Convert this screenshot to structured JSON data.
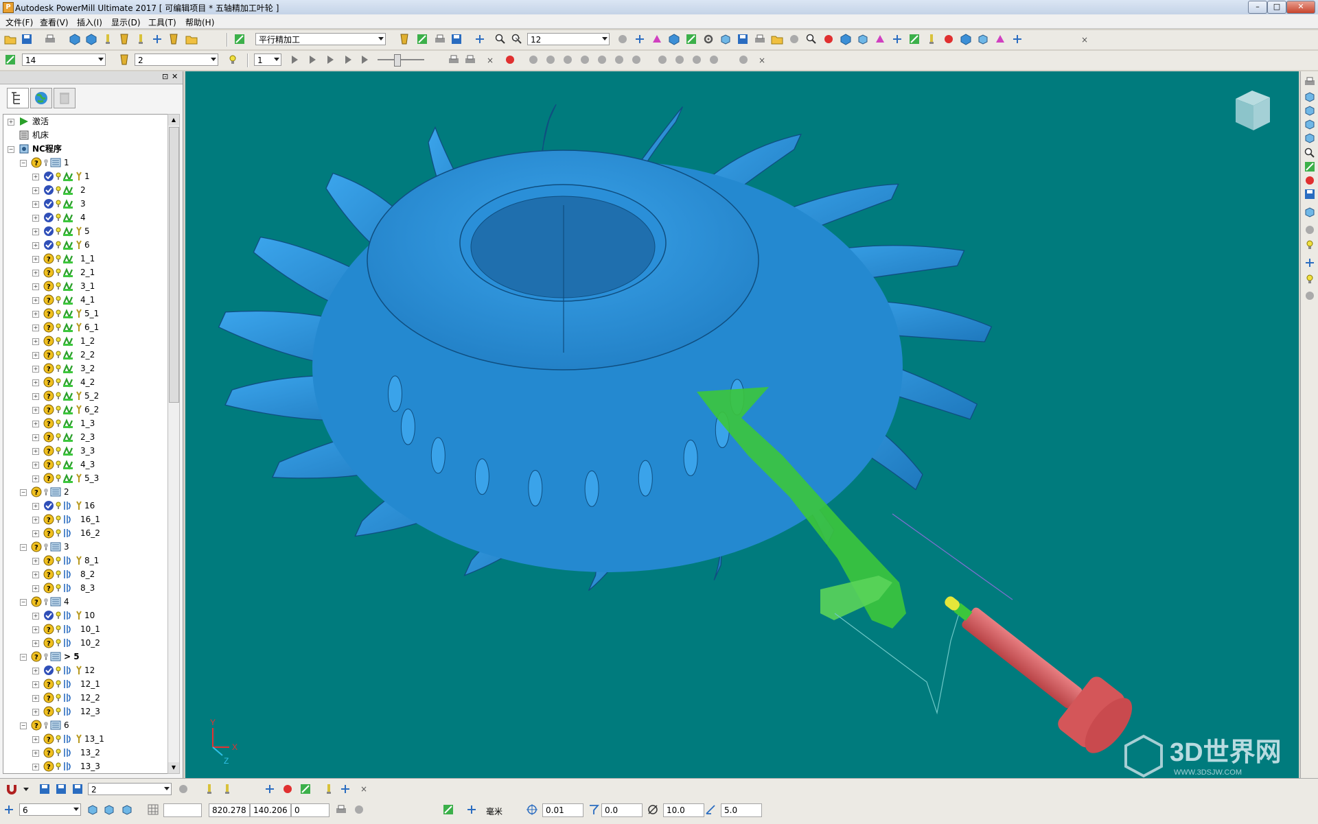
{
  "window": {
    "title": "Autodesk PowerMill Ultimate 2017   [ 可编辑项目 * 五轴精加工叶轮 ]",
    "minimize": "–",
    "maximize": "□",
    "close": "✕"
  },
  "menu": [
    "文件(F)",
    "查看(V)",
    "插入(I)",
    "显示(D)",
    "工具(T)",
    "帮助(H)"
  ],
  "toolbar1": {
    "strategy_combo": "平行精加工",
    "tool_combo": "12"
  },
  "toolbar2": {
    "combo_a": "14",
    "combo_b": "2",
    "combo_c": "1"
  },
  "explorer": {
    "header_pin": "⊡",
    "header_close": "✕"
  },
  "tree": [
    {
      "label": "激活",
      "level": 0,
      "expander": "+",
      "kind": "active"
    },
    {
      "label": "机床",
      "level": 0,
      "expander": "",
      "kind": "machine"
    },
    {
      "label": "NC程序",
      "level": 0,
      "expander": "−",
      "kind": "nc",
      "bold": true
    },
    {
      "label": "1",
      "level": 1,
      "expander": "−",
      "kind": "prog"
    },
    {
      "label": "1",
      "level": 2,
      "expander": "+",
      "kind": "tp",
      "status": "ok",
      "icon": "finish",
      "y": true
    },
    {
      "label": "2",
      "level": 2,
      "expander": "+",
      "kind": "tp",
      "status": "ok",
      "icon": "finish",
      "y": false
    },
    {
      "label": "3",
      "level": 2,
      "expander": "+",
      "kind": "tp",
      "status": "ok",
      "icon": "finish",
      "y": false
    },
    {
      "label": "4",
      "level": 2,
      "expander": "+",
      "kind": "tp",
      "status": "ok",
      "icon": "finish",
      "y": false
    },
    {
      "label": "5",
      "level": 2,
      "expander": "+",
      "kind": "tp",
      "status": "ok",
      "icon": "finish",
      "y": true
    },
    {
      "label": "6",
      "level": 2,
      "expander": "+",
      "kind": "tp",
      "status": "ok",
      "icon": "finish",
      "y": true
    },
    {
      "label": "1_1",
      "level": 2,
      "expander": "+",
      "kind": "tp",
      "status": "q",
      "icon": "finish",
      "y": false
    },
    {
      "label": "2_1",
      "level": 2,
      "expander": "+",
      "kind": "tp",
      "status": "q",
      "icon": "finish",
      "y": false
    },
    {
      "label": "3_1",
      "level": 2,
      "expander": "+",
      "kind": "tp",
      "status": "q",
      "icon": "finish",
      "y": false
    },
    {
      "label": "4_1",
      "level": 2,
      "expander": "+",
      "kind": "tp",
      "status": "q",
      "icon": "finish",
      "y": false
    },
    {
      "label": "5_1",
      "level": 2,
      "expander": "+",
      "kind": "tp",
      "status": "q",
      "icon": "finish",
      "y": true
    },
    {
      "label": "6_1",
      "level": 2,
      "expander": "+",
      "kind": "tp",
      "status": "q",
      "icon": "finish",
      "y": true
    },
    {
      "label": "1_2",
      "level": 2,
      "expander": "+",
      "kind": "tp",
      "status": "q",
      "icon": "finish",
      "y": false
    },
    {
      "label": "2_2",
      "level": 2,
      "expander": "+",
      "kind": "tp",
      "status": "q",
      "icon": "finish",
      "y": false
    },
    {
      "label": "3_2",
      "level": 2,
      "expander": "+",
      "kind": "tp",
      "status": "q",
      "icon": "finish",
      "y": false
    },
    {
      "label": "4_2",
      "level": 2,
      "expander": "+",
      "kind": "tp",
      "status": "q",
      "icon": "finish",
      "y": false
    },
    {
      "label": "5_2",
      "level": 2,
      "expander": "+",
      "kind": "tp",
      "status": "q",
      "icon": "finish",
      "y": true
    },
    {
      "label": "6_2",
      "level": 2,
      "expander": "+",
      "kind": "tp",
      "status": "q",
      "icon": "finish",
      "y": true
    },
    {
      "label": "1_3",
      "level": 2,
      "expander": "+",
      "kind": "tp",
      "status": "q",
      "icon": "finish",
      "y": false
    },
    {
      "label": "2_3",
      "level": 2,
      "expander": "+",
      "kind": "tp",
      "status": "q",
      "icon": "finish",
      "y": false
    },
    {
      "label": "3_3",
      "level": 2,
      "expander": "+",
      "kind": "tp",
      "status": "q",
      "icon": "finish",
      "y": false
    },
    {
      "label": "4_3",
      "level": 2,
      "expander": "+",
      "kind": "tp",
      "status": "q",
      "icon": "finish",
      "y": false
    },
    {
      "label": "5_3",
      "level": 2,
      "expander": "+",
      "kind": "tp",
      "status": "q",
      "icon": "finish",
      "y": true
    },
    {
      "label": "2",
      "level": 1,
      "expander": "−",
      "kind": "prog"
    },
    {
      "label": "16",
      "level": 2,
      "expander": "+",
      "kind": "tp",
      "status": "ok",
      "icon": "swarf",
      "y": true
    },
    {
      "label": "16_1",
      "level": 2,
      "expander": "+",
      "kind": "tp",
      "status": "q",
      "icon": "swarf",
      "y": false
    },
    {
      "label": "16_2",
      "level": 2,
      "expander": "+",
      "kind": "tp",
      "status": "q",
      "icon": "swarf",
      "y": false
    },
    {
      "label": "3",
      "level": 1,
      "expander": "−",
      "kind": "prog"
    },
    {
      "label": "8_1",
      "level": 2,
      "expander": "+",
      "kind": "tp",
      "status": "q",
      "icon": "swarf",
      "y": true
    },
    {
      "label": "8_2",
      "level": 2,
      "expander": "+",
      "kind": "tp",
      "status": "q",
      "icon": "swarf",
      "y": false
    },
    {
      "label": "8_3",
      "level": 2,
      "expander": "+",
      "kind": "tp",
      "status": "q",
      "icon": "swarf",
      "y": false
    },
    {
      "label": "4",
      "level": 1,
      "expander": "−",
      "kind": "prog"
    },
    {
      "label": "10",
      "level": 2,
      "expander": "+",
      "kind": "tp",
      "status": "ok",
      "icon": "swarf",
      "y": true
    },
    {
      "label": "10_1",
      "level": 2,
      "expander": "+",
      "kind": "tp",
      "status": "q",
      "icon": "swarf",
      "y": false
    },
    {
      "label": "10_2",
      "level": 2,
      "expander": "+",
      "kind": "tp",
      "status": "q",
      "icon": "swarf",
      "y": false
    },
    {
      "label": "> 5",
      "level": 1,
      "expander": "−",
      "kind": "prog",
      "bold": true
    },
    {
      "label": "12",
      "level": 2,
      "expander": "+",
      "kind": "tp",
      "status": "ok",
      "icon": "swarf",
      "y": true
    },
    {
      "label": "12_1",
      "level": 2,
      "expander": "+",
      "kind": "tp",
      "status": "q",
      "icon": "swarf",
      "y": false
    },
    {
      "label": "12_2",
      "level": 2,
      "expander": "+",
      "kind": "tp",
      "status": "q",
      "icon": "swarf",
      "y": false
    },
    {
      "label": "12_3",
      "level": 2,
      "expander": "+",
      "kind": "tp",
      "status": "q",
      "icon": "swarf",
      "y": false
    },
    {
      "label": "6",
      "level": 1,
      "expander": "−",
      "kind": "prog"
    },
    {
      "label": "13_1",
      "level": 2,
      "expander": "+",
      "kind": "tp",
      "status": "q",
      "icon": "swarf",
      "y": true
    },
    {
      "label": "13_2",
      "level": 2,
      "expander": "+",
      "kind": "tp",
      "status": "q",
      "icon": "swarf",
      "y": false
    },
    {
      "label": "13_3",
      "level": 2,
      "expander": "+",
      "kind": "tp",
      "status": "q",
      "icon": "swarf",
      "y": false
    }
  ],
  "axis": {
    "x": "X",
    "y": "Y",
    "z": "Z"
  },
  "bottom_toolbar": {
    "combo": "2"
  },
  "status_bar": {
    "workplane_combo": "6",
    "x_coord": "820.278",
    "y_coord": "140.206",
    "z_coord": "0",
    "units": "毫米",
    "tolerance": "0.01",
    "stock": "0.0",
    "tool_diameter": "10.0",
    "stepover": "5.0"
  },
  "watermark": {
    "text": "3D世界网",
    "url": "WWW.3DSJW.COM"
  },
  "colors": {
    "viewport_bg": "#007b7d",
    "model_blue": "#2a8fd6",
    "toolpath_green": "#3cc63c",
    "tool_red": "#d95c60"
  }
}
